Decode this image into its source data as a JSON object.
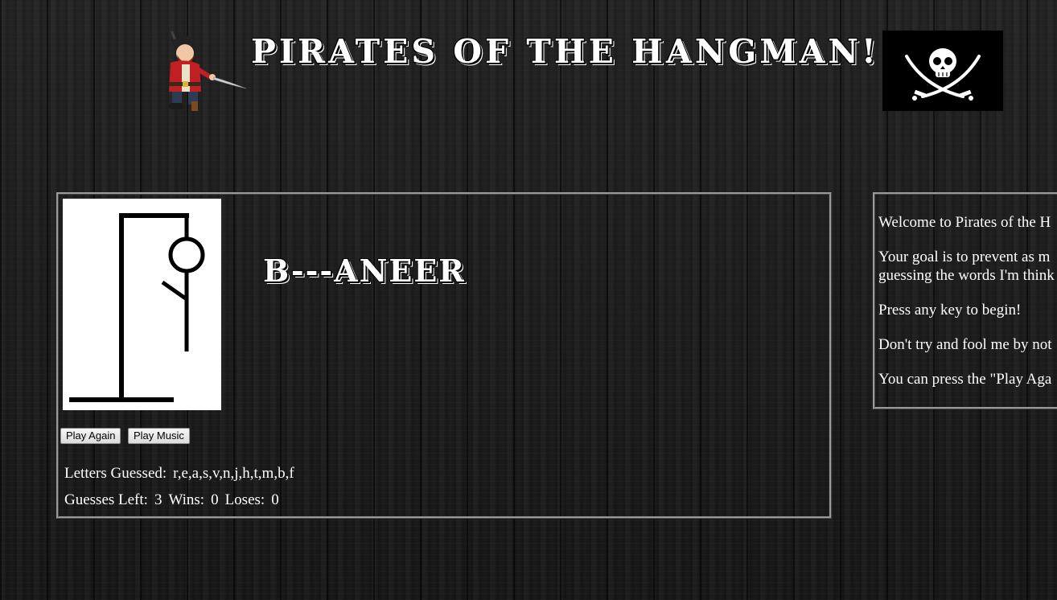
{
  "header": {
    "title": "PIRATES OF THE HANGMAN!",
    "pirate_image": "pirate-character-icon",
    "flag_image": "jolly-roger-skull-crossed-swords-icon"
  },
  "game": {
    "word_display": "B---ANEER",
    "hangman_image": "hangman-gallows-partial-figure",
    "buttons": {
      "play_again": "Play Again",
      "play_music": "Play Music"
    },
    "letters_guessed_label": "Letters Guessed:",
    "letters_guessed_value": "r,e,a,s,v,n,j,h,t,m,b,f",
    "guesses_left_label": "Guesses Left:",
    "guesses_left_value": "3",
    "wins_label": "Wins:",
    "wins_value": "0",
    "loses_label": "Loses:",
    "loses_value": "0"
  },
  "info": {
    "lines": [
      "Welcome to Pirates of the H",
      "Your goal is to prevent as m",
      "guessing the words I'm think",
      "Press any key to begin!",
      "Don't try and fool me by not",
      "You can press the \"Play Aga"
    ]
  },
  "colors": {
    "background": "#1b1b1b",
    "text": "#ffffff",
    "panel_border": "#9a9a9a"
  }
}
